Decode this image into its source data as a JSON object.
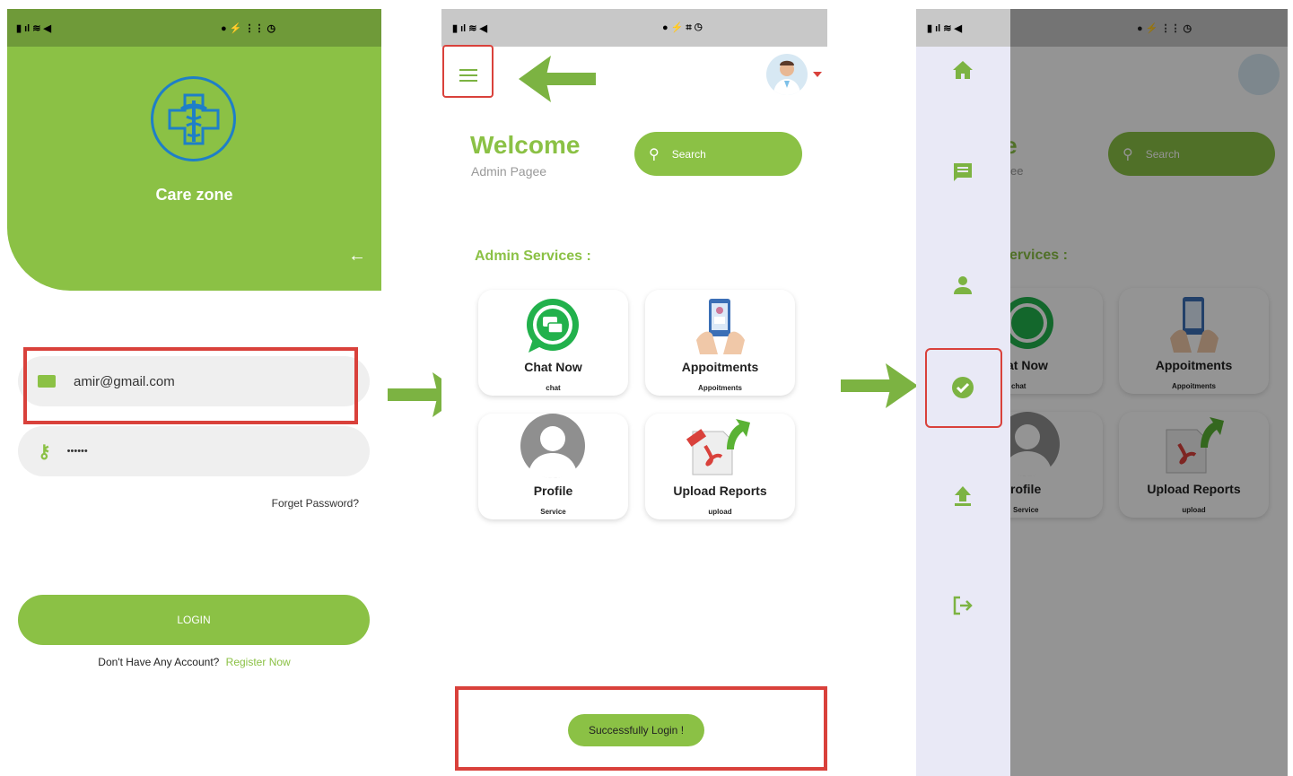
{
  "login": {
    "app_name": "Care zone",
    "email": "amir@gmail.com",
    "password": "••••••",
    "forgot": "Forget Password?",
    "login_label": "LOGIN",
    "no_account": "Don't Have Any Account?",
    "register": "Register Now"
  },
  "admin": {
    "welcome": "Welcome",
    "subtitle": "Admin Pagee",
    "search_placeholder": "Search",
    "services_title": "Admin Services :",
    "cards": [
      {
        "title": "Chat Now",
        "sub": "chat"
      },
      {
        "title": "Appoitments",
        "sub": "Appoitments"
      },
      {
        "title": "Profile",
        "sub": "Service"
      },
      {
        "title": "Upload Reports",
        "sub": "upload"
      }
    ],
    "toast": "Successfully Login !"
  },
  "drawer": {
    "welcome_partial": "me",
    "subtitle_partial": "ee",
    "services_partial": "ervices :",
    "search_placeholder": "Search",
    "cards": [
      {
        "title": "at Now",
        "sub": "chat"
      },
      {
        "title": "Appoitments",
        "sub": "Appoitments"
      },
      {
        "title": "rofile",
        "sub": "Service"
      },
      {
        "title": "Upload Reports",
        "sub": "upload"
      }
    ],
    "items": [
      "home-icon",
      "message-icon",
      "person-icon",
      "check-circle-icon",
      "upload-icon",
      "logout-icon"
    ]
  },
  "colors": {
    "primary": "#8bc145",
    "dark_primary": "#6f9a39",
    "highlight": "#d9413b",
    "arrow": "#7cb342",
    "drawer": "#e9e9f6"
  }
}
